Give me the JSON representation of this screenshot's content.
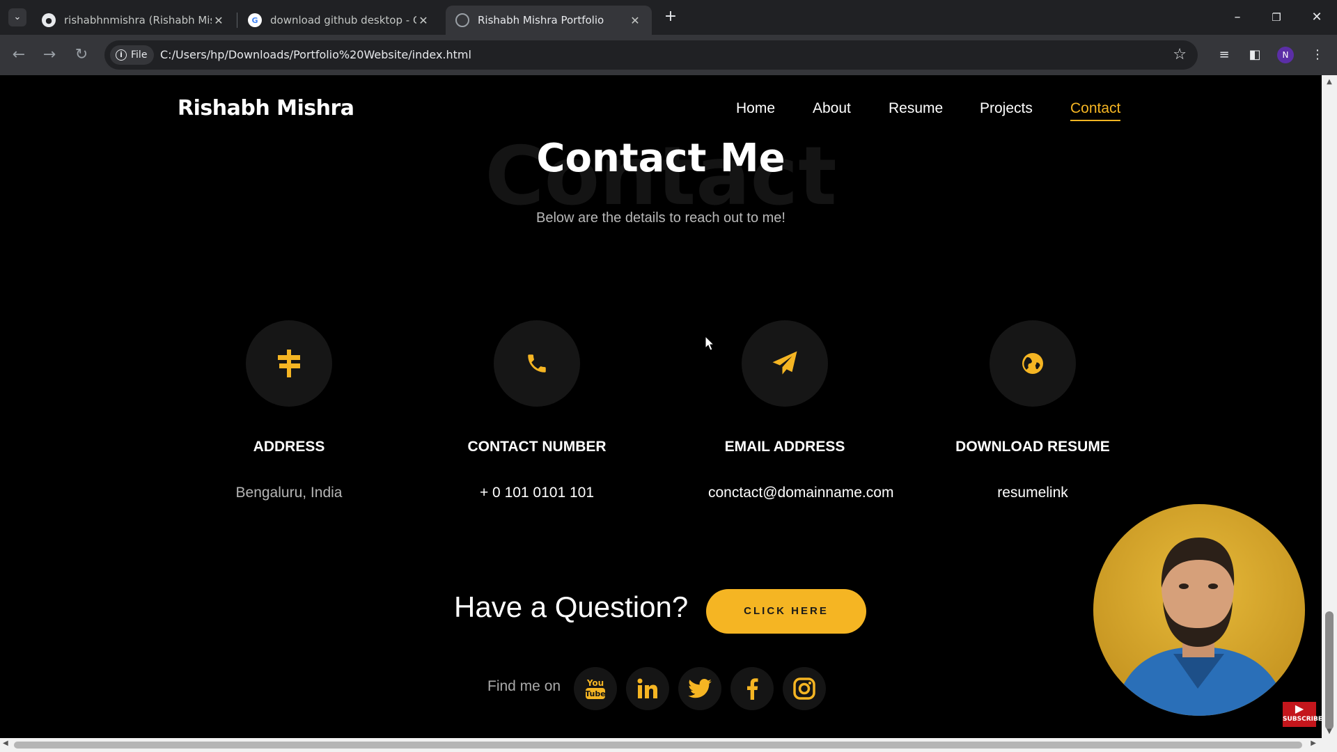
{
  "browser": {
    "tabs": [
      {
        "title": "rishabhnmishra (Rishabh Mishra)",
        "icon": "github-icon",
        "active": false
      },
      {
        "title": "download github desktop - Google",
        "icon": "google-icon",
        "active": false
      },
      {
        "title": "Rishabh Mishra Portfolio",
        "icon": "globe-icon",
        "active": true
      }
    ],
    "chip_label": "File",
    "url": "C:/Users/hp/Downloads/Portfolio%20Website/index.html",
    "profile_initial": "N"
  },
  "site": {
    "logo": "Rishabh Mishra",
    "nav": [
      {
        "label": "Home",
        "active": false
      },
      {
        "label": "About",
        "active": false
      },
      {
        "label": "Resume",
        "active": false
      },
      {
        "label": "Projects",
        "active": false
      },
      {
        "label": "Contact",
        "active": true
      }
    ],
    "section_bg_text": "Contact",
    "section_title": "Contact Me",
    "section_subtitle": "Below are the details to reach out to me!",
    "cards": [
      {
        "icon": "signpost-icon",
        "title": "ADDRESS",
        "value": "Bengaluru, India"
      },
      {
        "icon": "phone-icon",
        "title": "CONTACT NUMBER",
        "value": "+ 0 101 0101 101"
      },
      {
        "icon": "paper-plane-icon",
        "title": "EMAIL ADDRESS",
        "value": "conctact@domainname.com"
      },
      {
        "icon": "globe-icon",
        "title": "DOWNLOAD RESUME",
        "value": "resumelink"
      }
    ],
    "question": "Have a Question?",
    "cta_label": "CLICK HERE",
    "find_me": "Find me on",
    "socials": [
      "youtube-icon",
      "linkedin-icon",
      "twitter-icon",
      "facebook-icon",
      "instagram-icon"
    ]
  },
  "overlay": {
    "subscribe_label": "SUBSCRIBE"
  },
  "colors": {
    "accent": "#f5b523",
    "background": "#000000",
    "card_circle": "#161616"
  }
}
